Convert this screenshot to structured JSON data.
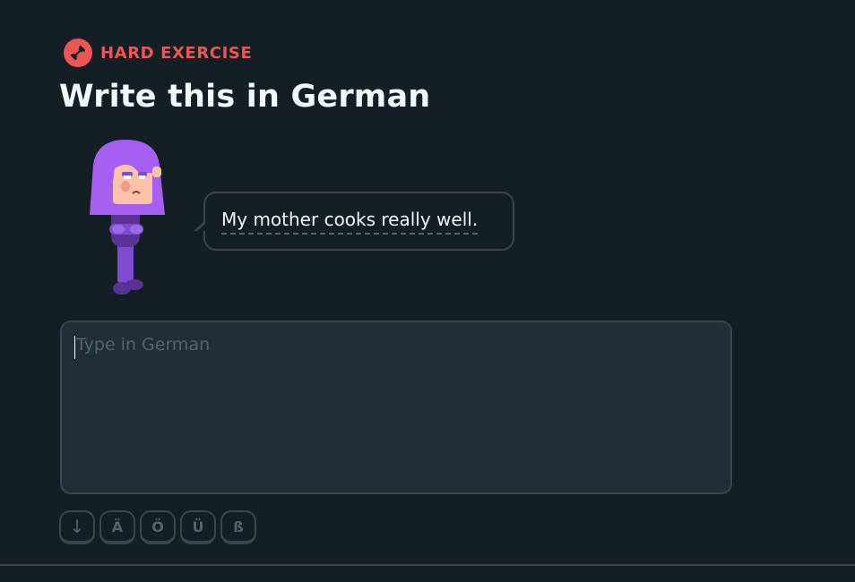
{
  "header": {
    "badge_label": "HARD EXERCISE",
    "badge_icon": "dumbbell-icon",
    "title": "Write this in German"
  },
  "prompt": {
    "sentence": "My mother cooks really well."
  },
  "answer": {
    "placeholder": "Type in German",
    "value": ""
  },
  "special_keys": [
    {
      "label": "↓",
      "icon": "arrow-down-icon"
    },
    {
      "label": "Ä"
    },
    {
      "label": "Ö"
    },
    {
      "label": "Ü"
    },
    {
      "label": "ß"
    }
  ],
  "colors": {
    "background": "#131f24",
    "accent_red": "#ee5555",
    "border": "#37464f",
    "input_bg": "#202f36",
    "text": "#f1f7fb",
    "muted": "#52656d",
    "character_hair": "#a560f2",
    "character_body": "#7e4bd1"
  }
}
